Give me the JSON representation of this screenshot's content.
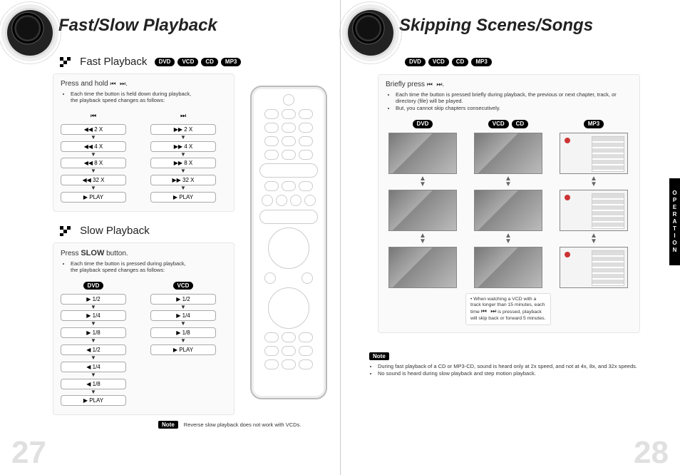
{
  "left": {
    "title": "Fast/Slow Playback",
    "page_number": "27",
    "section_fast": {
      "heading": "Fast Playback",
      "formats": [
        "DVD",
        "VCD",
        "CD",
        "MP3"
      ],
      "instruction_prefix": "Press and hold",
      "instruction_glyphs": "⏮ ⏭",
      "instruction_suffix": ".",
      "bullet1": "Each time the button is held down during playback,",
      "bullet1b": "the playback speed changes as follows:",
      "rev_steps": [
        "◀◀  2 X",
        "◀◀  4 X",
        "◀◀  8 X",
        "◀◀  32 X",
        "▶  PLAY"
      ],
      "fwd_steps": [
        "▶▶  2 X",
        "▶▶  4 X",
        "▶▶  8 X",
        "▶▶  32 X",
        "▶  PLAY"
      ],
      "rev_icon": "⏮",
      "fwd_icon": "⏭"
    },
    "section_slow": {
      "heading": "Slow Playback",
      "instruction_prefix": "Press",
      "instruction_key": "SLOW",
      "instruction_suffix": "button.",
      "bullet1": "Each time the button is pressed during playback,",
      "bullet1b": "the playback speed changes as follows:",
      "col1_label": "DVD",
      "col2_label": "VCD",
      "dvd_steps": [
        "▶  1/2",
        "▶  1/4",
        "▶  1/8",
        "◀  1/2",
        "◀  1/4",
        "◀  1/8",
        "▶  PLAY"
      ],
      "vcd_steps": [
        "▶  1/2",
        "▶  1/4",
        "▶  1/8",
        "▶  PLAY"
      ],
      "note_label": "Note",
      "note_text": "Reverse slow playback does not work with VCDs."
    }
  },
  "right": {
    "title": "Skipping Scenes/Songs",
    "page_number": "28",
    "side_tab": "OPERATION",
    "formats": [
      "DVD",
      "VCD",
      "CD",
      "MP3"
    ],
    "panel": {
      "instruction_prefix": "Briefly press",
      "instruction_glyphs": "⏮ ⏭",
      "instruction_suffix": ".",
      "bullet1": "Each time the button is pressed briefly during playback, the previous or next chapter, track, or directory (file) will be played.",
      "bullet2": "But, you cannot skip chapters consecutively.",
      "col1_label": "DVD",
      "col2_labels": [
        "VCD",
        "CD"
      ],
      "col3_label": "MP3",
      "vcd_note_l1": "When watching a VCD with a track longer than 15 minutes, each time",
      "vcd_note_glyphs": "⏮ ⏭",
      "vcd_note_l2": "is pressed, playback will skip back or forward 5 minutes."
    },
    "note": {
      "label": "Note",
      "b1": "During fast playback of a CD or MP3-CD, sound is heard only at 2x speed, and not at 4x, 8x, and 32x speeds.",
      "b2": "No sound is heard during slow playback and step motion playback."
    }
  }
}
